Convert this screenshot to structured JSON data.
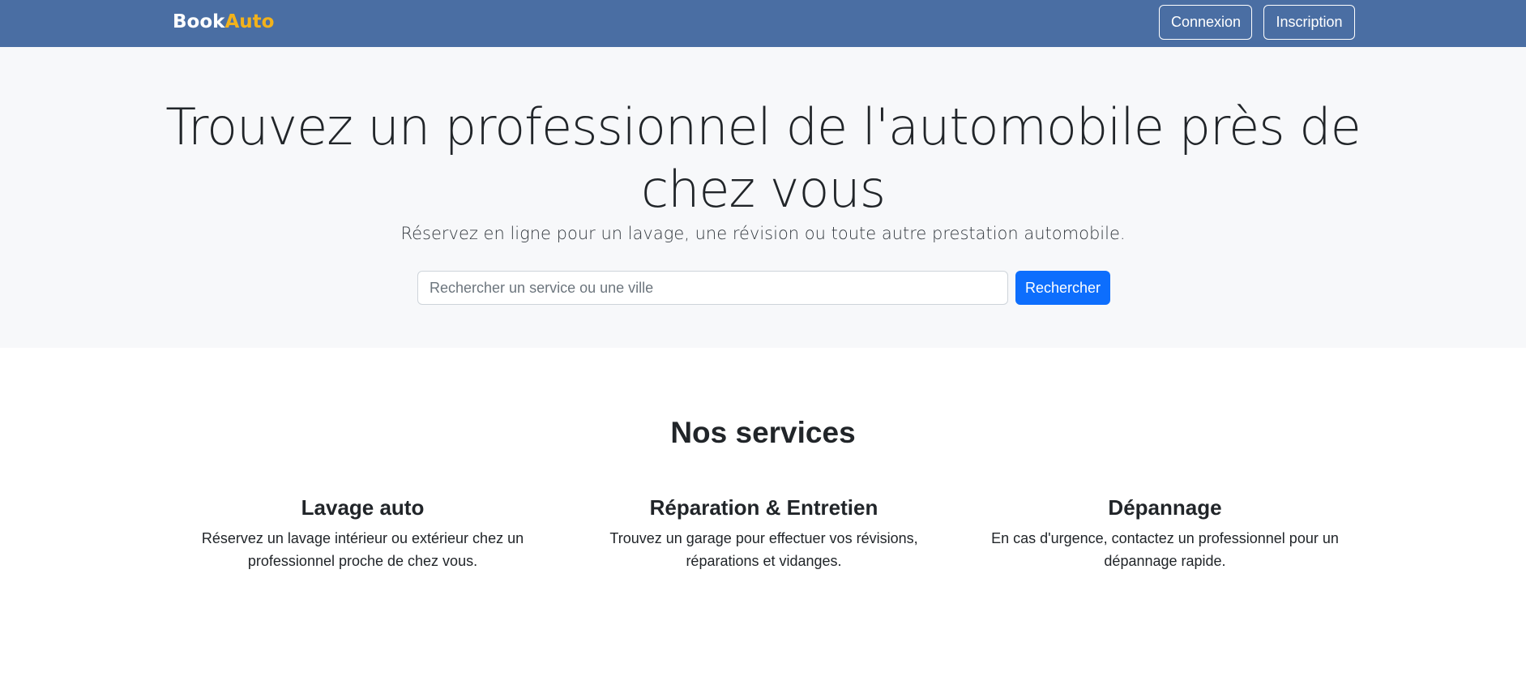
{
  "navbar": {
    "brand_part1": "Book",
    "brand_part2": "Auto",
    "login_label": "Connexion",
    "signup_label": "Inscription"
  },
  "hero": {
    "title": "Trouvez un professionnel de l'automobile près de chez vous",
    "subtitle": "Réservez en ligne pour un lavage, une révision ou toute autre prestation automobile.",
    "search_placeholder": "Rechercher un service ou une ville",
    "search_value": "",
    "search_button": "Rechercher"
  },
  "services": {
    "title": "Nos services",
    "items": [
      {
        "title": "Lavage auto",
        "description": "Réservez un lavage intérieur ou extérieur chez un professionnel proche de chez vous."
      },
      {
        "title": "Réparation & Entretien",
        "description": "Trouvez un garage pour effectuer vos révisions, réparations et vidanges."
      },
      {
        "title": "Dépannage",
        "description": "En cas d'urgence, contactez un professionnel pour un dépannage rapide."
      }
    ]
  },
  "colors": {
    "navbar_bg": "#4a6ea3",
    "brand_accent": "#f2b21b",
    "hero_bg": "#f7f8fa",
    "primary_button": "#0d6efd"
  }
}
